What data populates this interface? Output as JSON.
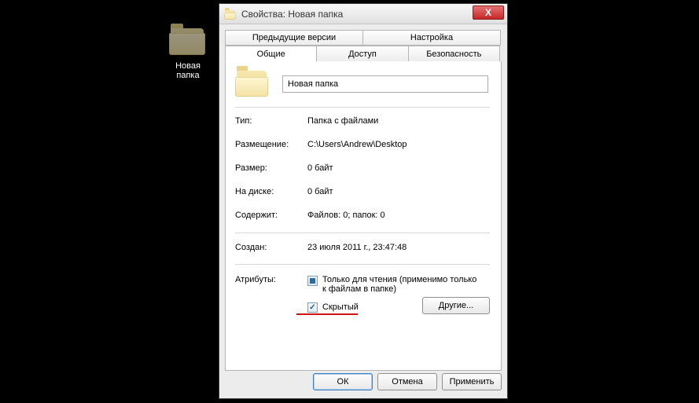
{
  "desktop": {
    "folder_label": "Новая папка"
  },
  "window": {
    "title": "Свойства: Новая папка",
    "close_glyph": "X"
  },
  "tabs_top": [
    {
      "label": "Предыдущие версии"
    },
    {
      "label": "Настройка"
    }
  ],
  "tabs_bottom": [
    {
      "label": "Общие"
    },
    {
      "label": "Доступ"
    },
    {
      "label": "Безопасность"
    }
  ],
  "general": {
    "name_value": "Новая папка",
    "rows": {
      "type_label": "Тип:",
      "type_value": "Папка с файлами",
      "loc_label": "Размещение:",
      "loc_value": "C:\\Users\\Andrew\\Desktop",
      "size_label": "Размер:",
      "size_value": "0 байт",
      "disk_label": "На диске:",
      "disk_value": "0 байт",
      "contains_label": "Содержит:",
      "contains_value": "Файлов: 0; папок: 0",
      "created_label": "Создан:",
      "created_value": "23 июля 2011 г., 23:47:48",
      "attr_label": "Атрибуты:"
    },
    "readonly_label": "Только для чтения (применимо только к файлам в папке)",
    "hidden_label": "Скрытый",
    "other_button": "Другие..."
  },
  "buttons": {
    "ok": "ОК",
    "cancel": "Отмена",
    "apply": "Применить"
  }
}
